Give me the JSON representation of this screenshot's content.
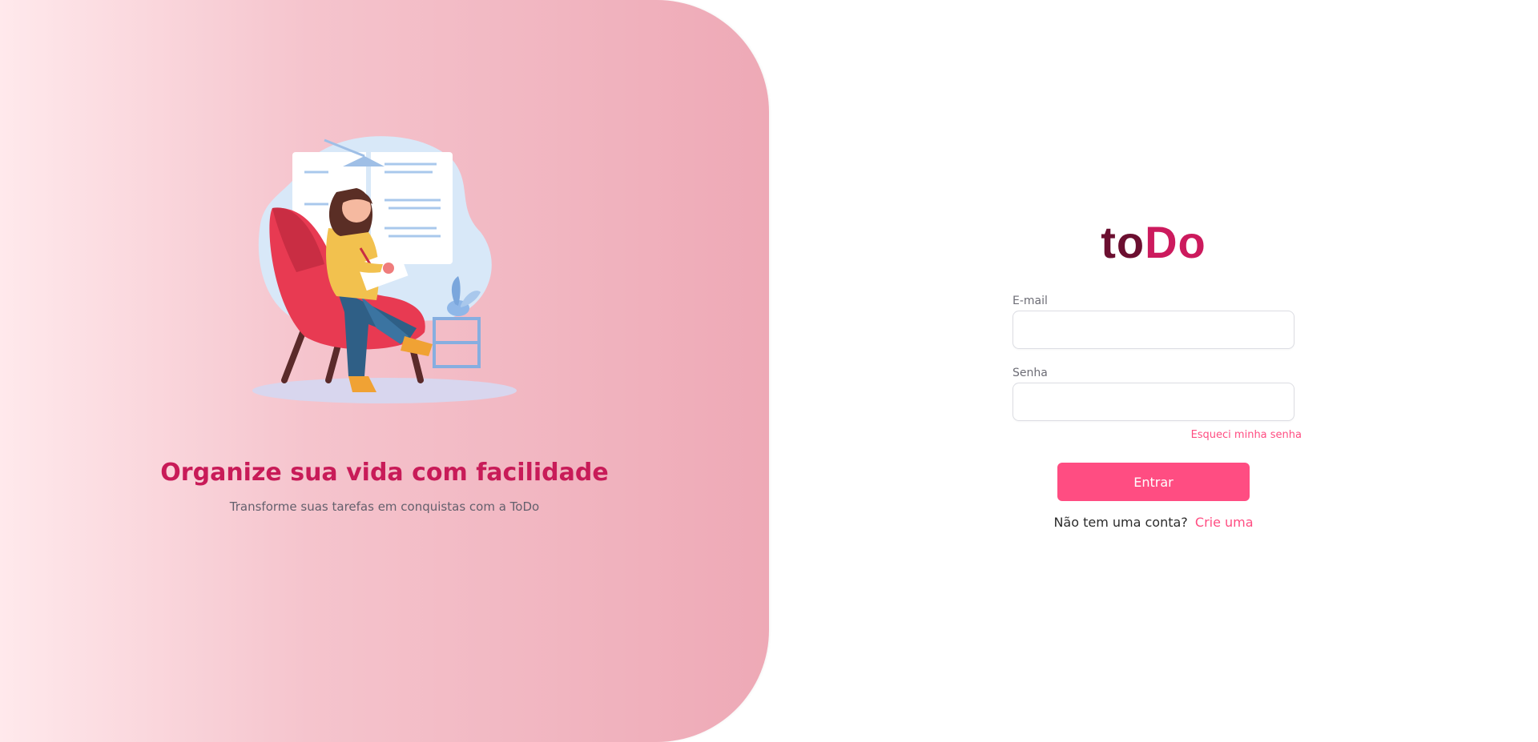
{
  "hero": {
    "title": "Organize sua vida com facilidade",
    "subtitle": "Transforme suas tarefas em conquistas com a ToDo"
  },
  "logo": {
    "part1": "to",
    "part2": "Do"
  },
  "form": {
    "email_label": "E-mail",
    "email_value": "",
    "password_label": "Senha",
    "password_value": "",
    "forgot_link": "Esqueci minha senha",
    "submit_label": "Entrar",
    "signup_prompt": "Não tem uma conta?",
    "signup_link": "Crie uma"
  },
  "colors": {
    "accent": "#ff4d82",
    "brand_dark": "#6b0f30",
    "brand_pink": "#cc1a5d"
  },
  "icons": {
    "illustration": "woman-reading-illustration"
  }
}
